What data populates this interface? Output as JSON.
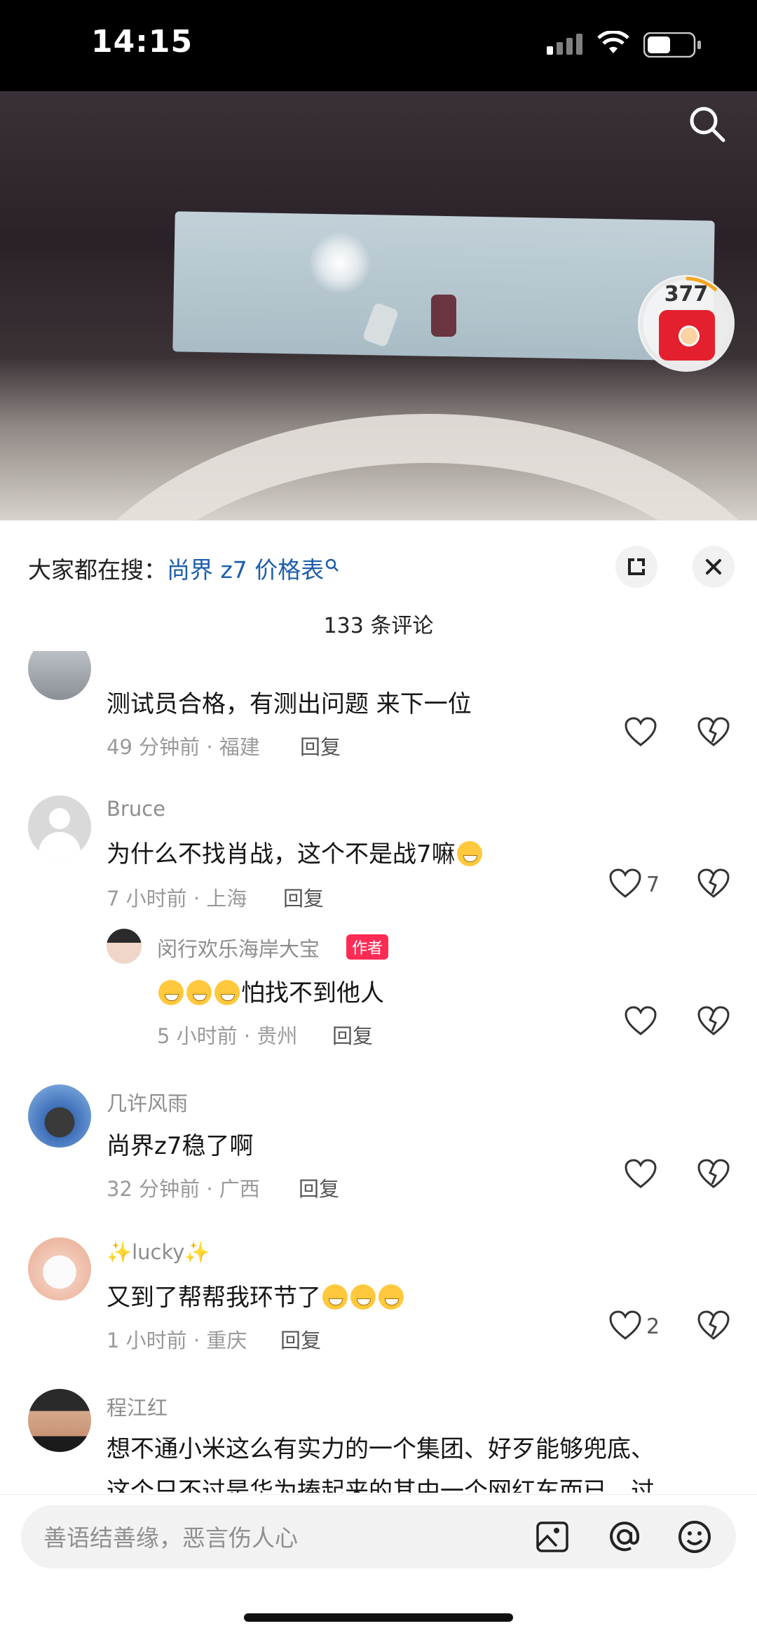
{
  "status": {
    "time": "14:15"
  },
  "video": {
    "redpacket_count": "377"
  },
  "sheet": {
    "search_prefix": "大家都在搜：",
    "search_term": "尚界 z7 价格表",
    "comment_count": "133 条评论",
    "reply_label": "回复",
    "author_tag": "作者"
  },
  "comments": [
    {
      "name": "",
      "text": "测试员合格，有测出问题  来下一位",
      "meta": "49 分钟前 · 福建",
      "likes": ""
    },
    {
      "name": "Bruce",
      "text": "为什么不找肖战，这个不是战7嘛",
      "meta": "7 小时前 · 上海",
      "likes": "7"
    },
    {
      "name": "闵行欢乐海岸大宝",
      "text": "怕找不到他人",
      "meta": "5 小时前 · 贵州",
      "likes": ""
    },
    {
      "name": "几许风雨",
      "text": "尚界z7稳了啊",
      "meta": "32 分钟前 · 广西",
      "likes": ""
    },
    {
      "name": "lucky",
      "text": "又到了帮帮我环节了",
      "meta": "1 小时前 · 重庆",
      "likes": "2"
    },
    {
      "name": "程江红",
      "text": "想不通小米这么有实力的一个集团、好歹能够兜底、",
      "text2": "这个只不过是华为捧起来的其中一个网红车而已，过"
    }
  ],
  "input": {
    "placeholder": "善语结善缘，恶言伤人心"
  },
  "colors": {
    "accent_link": "#1e5dab",
    "author_tag": "#fe2c55",
    "redpacket": "#e5202e"
  },
  "icons": [
    "search-icon",
    "expand-icon",
    "close-icon",
    "heart-icon",
    "dislike-icon",
    "image-icon",
    "at-icon",
    "emoji-icon"
  ]
}
